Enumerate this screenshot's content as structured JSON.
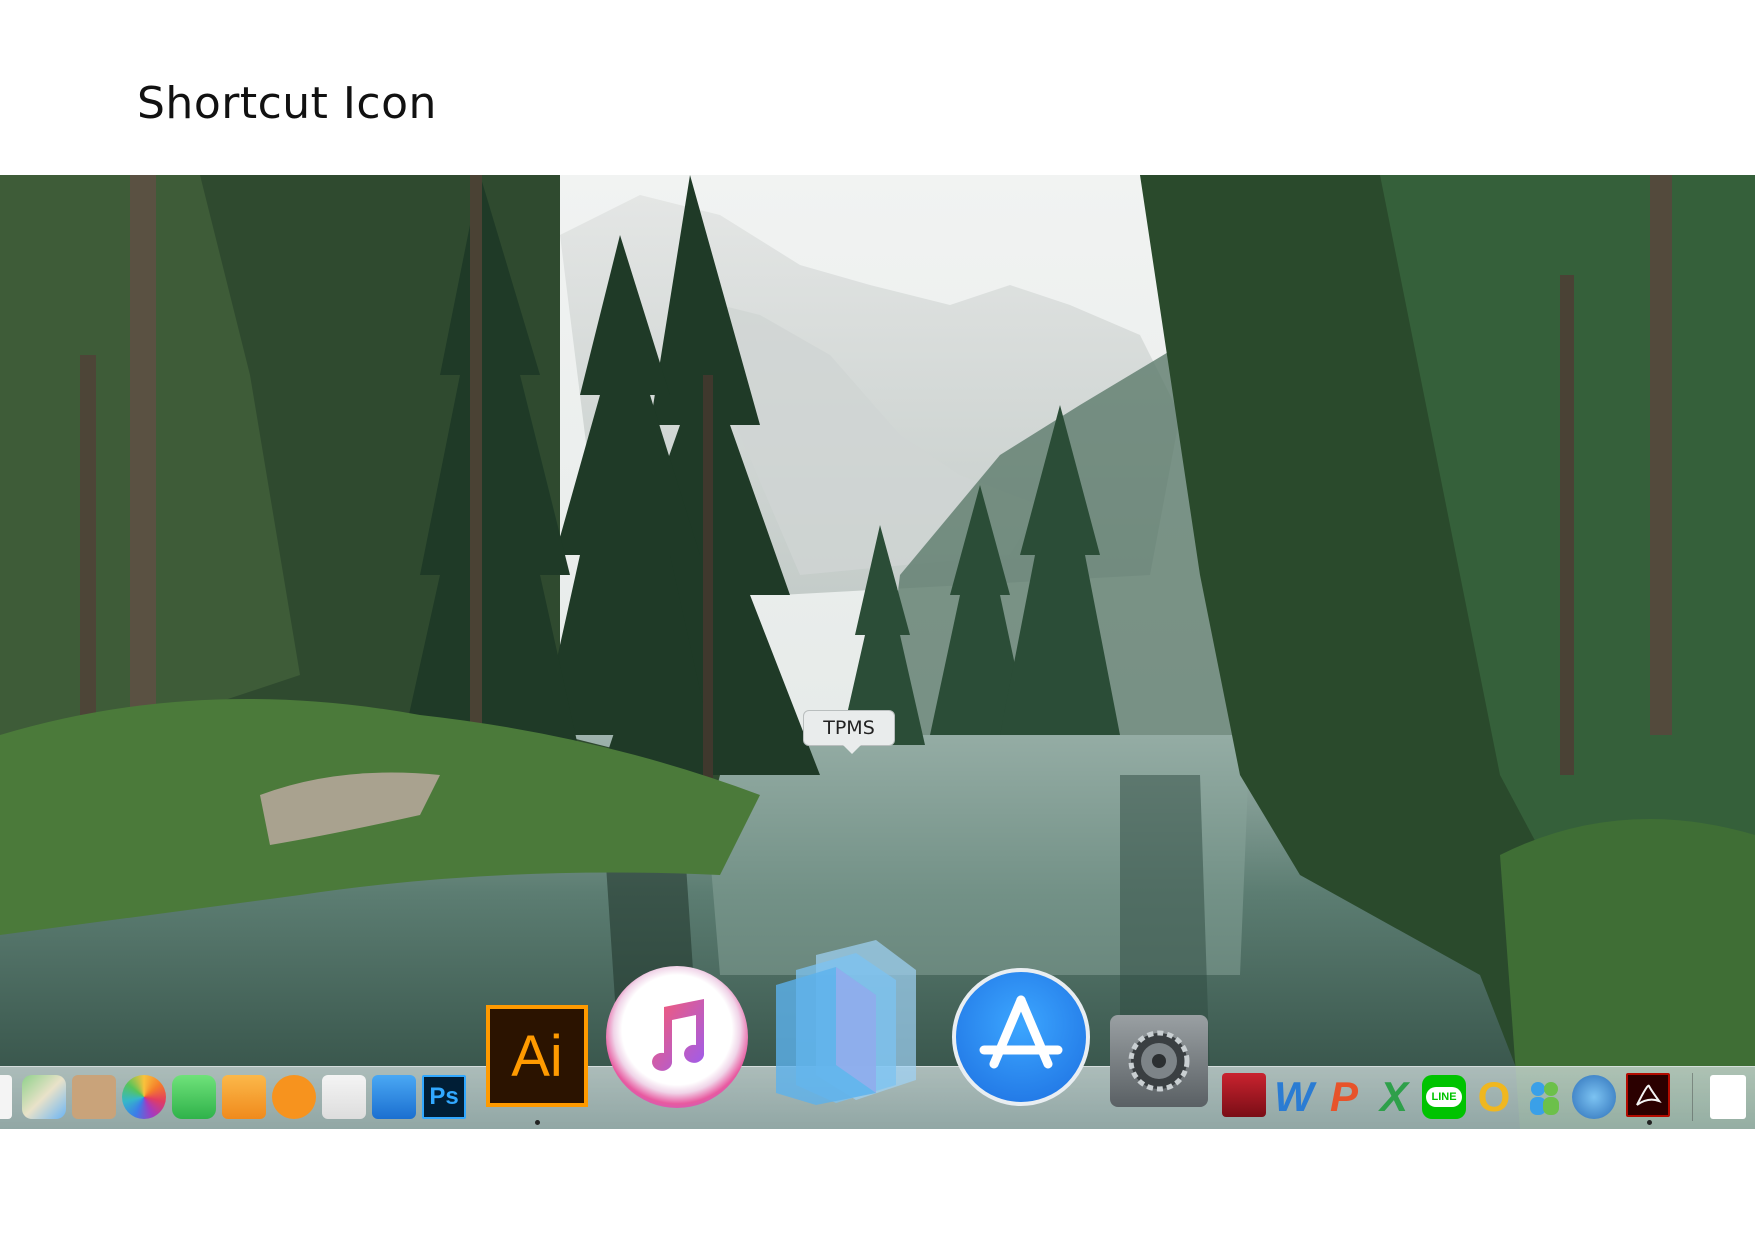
{
  "page": {
    "title": "Shortcut Icon"
  },
  "dock": {
    "tooltip": "TPMS",
    "icons": {
      "illustrator": "Ai",
      "photoshop": "Ps",
      "word": "W",
      "powerpoint": "P",
      "excel": "X",
      "line": "LINE",
      "outlook": "O"
    }
  },
  "colors": {
    "illustrator_bg": "#2b1300",
    "illustrator_accent": "#ff9a00",
    "photoshop_bg": "#001e36",
    "photoshop_accent": "#31a8ff",
    "appstore": "#1c8bf4",
    "itunes": "#f94f6f",
    "tpms": "#7cc3f2",
    "acrobat": "#b30b00",
    "line": "#00c300"
  }
}
